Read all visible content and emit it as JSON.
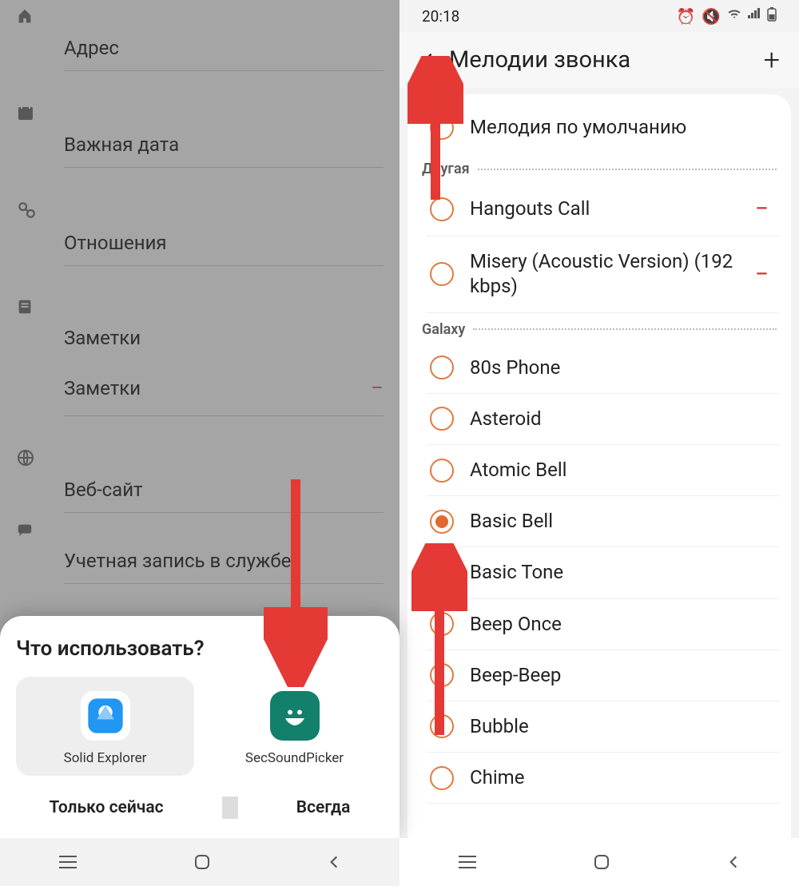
{
  "left": {
    "fields": {
      "address": "Адрес",
      "important_date": "Важная дата",
      "relations": "Отношения",
      "notes_header": "Заметки",
      "notes_item": "Заметки",
      "website": "Веб-сайт",
      "account": "Учетная запись в службе"
    },
    "sheet": {
      "title": "Что использовать?",
      "apps": [
        {
          "name": "Solid Explorer"
        },
        {
          "name": "SecSoundPicker"
        }
      ],
      "only_now": "Только сейчас",
      "always": "Всегда"
    }
  },
  "right": {
    "status_time": "20:18",
    "title": "Мелодии звонка",
    "default_item": "Мелодия по умолчанию",
    "group_other": "Другая",
    "other_items": [
      {
        "label": "Hangouts Call",
        "removable": true
      },
      {
        "label": "Misery (Acoustic Version) (192  kbps)",
        "removable": true
      }
    ],
    "group_galaxy": "Galaxy",
    "galaxy_items": [
      {
        "label": "80s Phone",
        "selected": false
      },
      {
        "label": "Asteroid",
        "selected": false
      },
      {
        "label": "Atomic Bell",
        "selected": false
      },
      {
        "label": "Basic Bell",
        "selected": true
      },
      {
        "label": "Basic Tone",
        "selected": false
      },
      {
        "label": "Beep Once",
        "selected": false
      },
      {
        "label": "Beep-Beep",
        "selected": false
      },
      {
        "label": "Bubble",
        "selected": false
      },
      {
        "label": "Chime",
        "selected": false
      }
    ]
  }
}
